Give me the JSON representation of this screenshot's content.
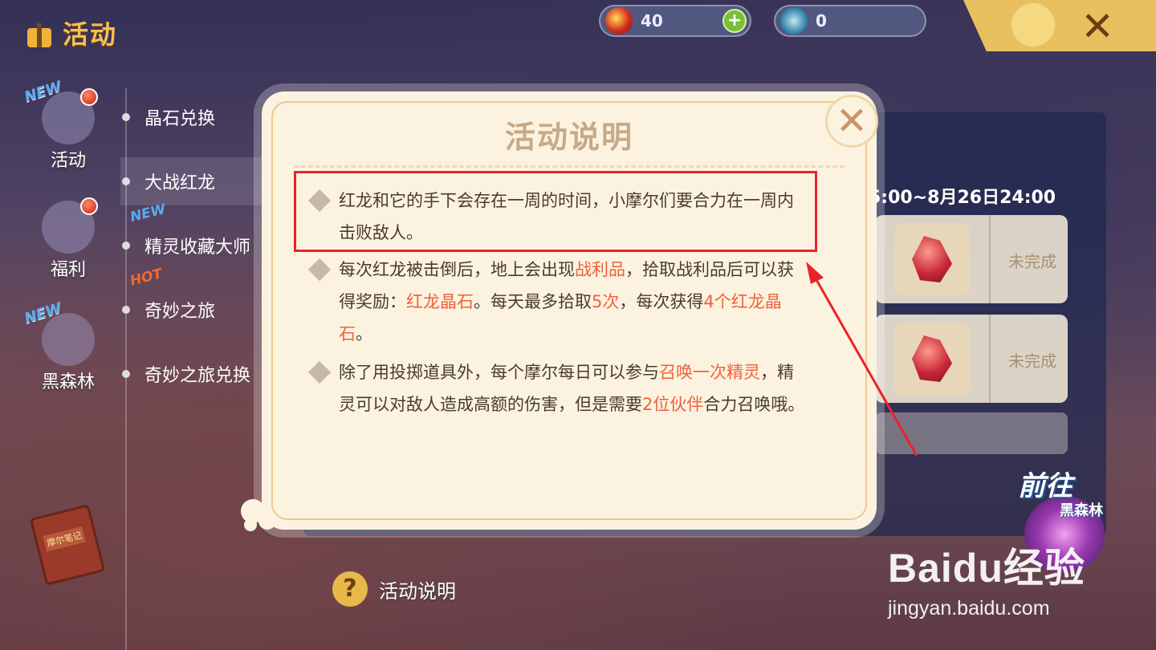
{
  "topbar": {
    "title": "活动",
    "currency_red": "40",
    "currency_blue": "0",
    "plus_label": "+",
    "close_label": "✕"
  },
  "leftnav": {
    "items": [
      {
        "label": "活动",
        "tag": "NEW",
        "icon": "gift-icon"
      },
      {
        "label": "福利",
        "tag": "",
        "icon": "heart-icon"
      },
      {
        "label": "黑森林",
        "tag": "NEW",
        "icon": "portal-icon"
      }
    ],
    "book_label": "摩尔笔记"
  },
  "sublist": {
    "items": [
      {
        "label": "晶石兑换",
        "tag": ""
      },
      {
        "label": "大战红龙",
        "tag": ""
      },
      {
        "label": "精灵收藏大师",
        "tag": "NEW"
      },
      {
        "label": "奇妙之旅",
        "tag": "HOT"
      },
      {
        "label": "奇妙之旅兑换",
        "tag": ""
      }
    ]
  },
  "panel": {
    "date_range": "5:00~8月26日24:00",
    "tasks": [
      {
        "status": "未完成"
      },
      {
        "status": "未完成"
      }
    ],
    "goto_label": "前往",
    "goto_sub": "黑森林",
    "help_label": "活动说明",
    "help_icon": "?"
  },
  "modal": {
    "title": "活动说明",
    "close_label": "✕",
    "p1": "红龙和它的手下会存在一周的时间，小摩尔们要合力在一周内击败敌人。",
    "p2_a": "每次红龙被击倒后，地上会出现",
    "p2_hl1": "战利品",
    "p2_b": "，拾取战利品后可以获得奖励：",
    "p2_hl2": "红龙晶石",
    "p2_c": "。每天最多拾取",
    "p2_hl3": "5次",
    "p2_d": "，每次获得",
    "p2_hl4": "4个红龙晶石",
    "p2_e": "。",
    "p3_a": "除了用投掷道具外，每个摩尔每日可以参与",
    "p3_hl1": "召唤一次精灵",
    "p3_b": "，精灵可以对敌人造成高额的伤害，但是需要",
    "p3_hl2": "2位伙伴",
    "p3_c": "合力召唤哦。"
  },
  "watermark": {
    "main": "Baidu经验",
    "sub": "jingyan.baidu.com"
  },
  "colors": {
    "highlight": "#f0603a",
    "annotation_red": "#e8242a",
    "title_gold": "#f4c050"
  }
}
